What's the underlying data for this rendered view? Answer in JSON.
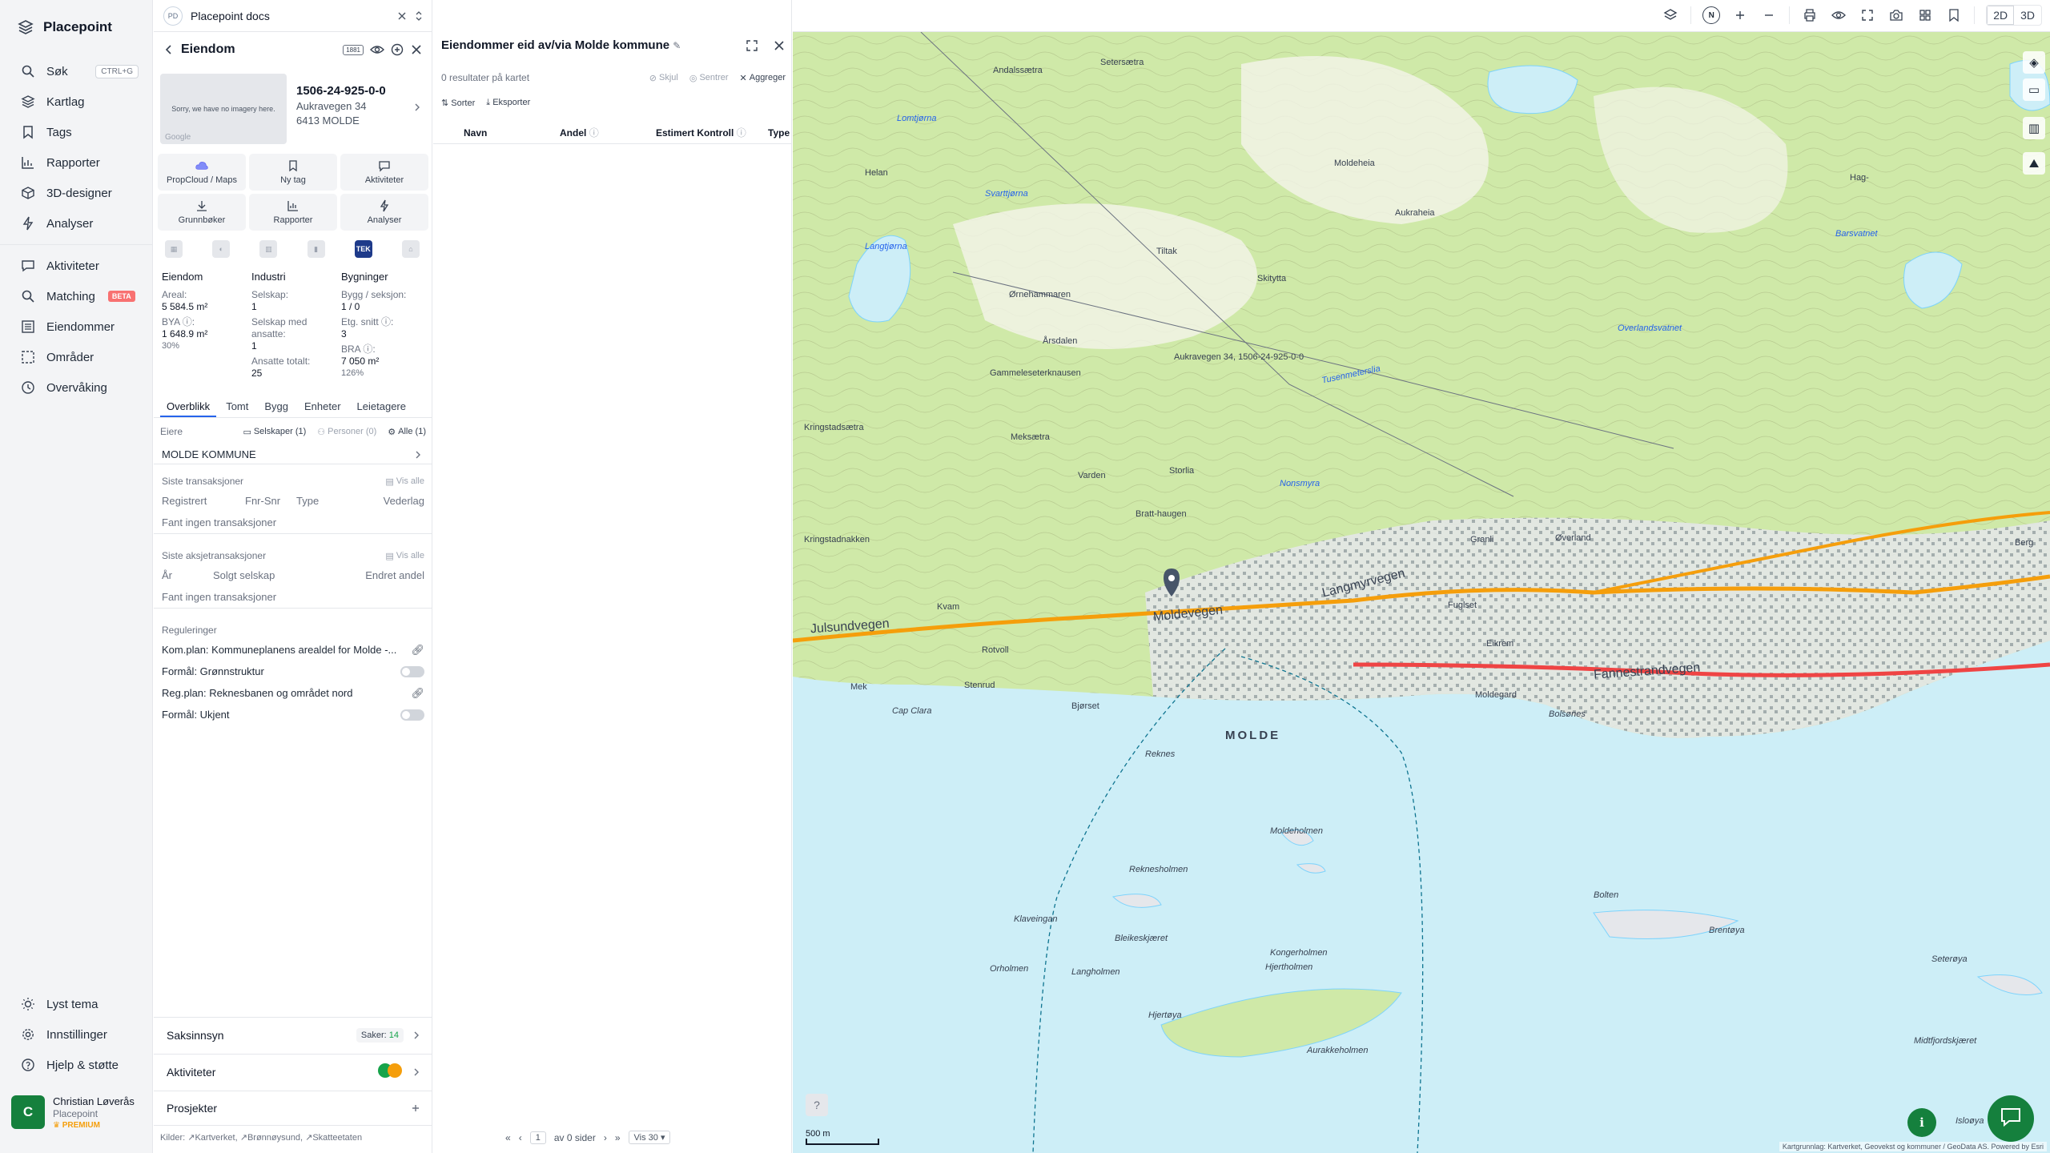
{
  "app": {
    "name": "Placepoint"
  },
  "nav": {
    "items": [
      {
        "label": "Søk",
        "icon": "search-icon",
        "kbd": "CTRL+G"
      },
      {
        "label": "Kartlag",
        "icon": "layers-icon"
      },
      {
        "label": "Tags",
        "icon": "bookmark-icon"
      },
      {
        "label": "Rapporter",
        "icon": "chart-icon"
      },
      {
        "label": "3D-designer",
        "icon": "cube-icon"
      },
      {
        "label": "Analyser",
        "icon": "bolt-icon"
      }
    ],
    "items2": [
      {
        "label": "Aktiviteter",
        "icon": "chat-icon"
      },
      {
        "label": "Matching",
        "icon": "search-icon",
        "badge": "BETA"
      },
      {
        "label": "Eiendommer",
        "icon": "list-icon"
      },
      {
        "label": "Områder",
        "icon": "area-icon"
      },
      {
        "label": "Overvåking",
        "icon": "clock-icon"
      }
    ],
    "bottom": [
      {
        "label": "Lyst tema",
        "icon": "sun-icon"
      },
      {
        "label": "Innstillinger",
        "icon": "gear-icon"
      },
      {
        "label": "Hjelp & støtte",
        "icon": "help-icon"
      }
    ],
    "user": {
      "initial": "C",
      "name": "Christian Løverås",
      "org": "Placepoint",
      "plan": "PREMIUM"
    }
  },
  "panel": {
    "doc": {
      "avatar": "PD",
      "name": "Placepoint docs"
    },
    "title": "Eiendom",
    "badge": "1881",
    "thumb_text": "Sorry, we have no imagery here.",
    "thumb_logo": "Google",
    "property": {
      "id": "1506-24-925-0-0",
      "address": "Aukravegen 34",
      "city": "6413 MOLDE"
    },
    "actions": [
      {
        "label": "PropCloud / Maps",
        "icon": "cloud-icon"
      },
      {
        "label": "Ny tag",
        "icon": "bookmark-icon"
      },
      {
        "label": "Aktiviteter",
        "icon": "chat-icon"
      },
      {
        "label": "Grunnbøker",
        "icon": "download-icon"
      },
      {
        "label": "Rapporter",
        "icon": "chart-icon"
      },
      {
        "label": "Analyser",
        "icon": "bolt-icon"
      }
    ],
    "mini_tek": "TEK",
    "stats": {
      "eiendom": {
        "head": "Eiendom",
        "areal_label": "Areal:",
        "areal": "5 584.5 m²",
        "bya_label": "BYA ⓘ:",
        "bya": "1 648.9 m²",
        "bya_pct": "30%"
      },
      "industri": {
        "head": "Industri",
        "selskap_label": "Selskap:",
        "selskap": "1",
        "ansatte_label": "Selskap med ansatte:",
        "ansatte": "1",
        "totalt_label": "Ansatte totalt:",
        "totalt": "25"
      },
      "bygninger": {
        "head": "Bygninger",
        "bygg_label": "Bygg / seksjon:",
        "bygg": "1 / 0",
        "etg_label": "Etg. snitt ⓘ:",
        "etg": "3",
        "bra_label": "BRA ⓘ:",
        "bra": "7 050 m²",
        "bra_pct": "126%"
      }
    },
    "tabs": [
      "Overblikk",
      "Tomt",
      "Bygg",
      "Enheter",
      "Leietagere"
    ],
    "owners": {
      "label": "Eiere",
      "f1": "Selskaper (1)",
      "f2": "Personer (0)",
      "f3": "Alle (1)",
      "owner": "MOLDE KOMMUNE"
    },
    "transactions": {
      "title": "Siste transaksjoner",
      "vis_alle": "Vis alle",
      "cols": [
        "Registrert",
        "Fnr-Snr",
        "Type",
        "Vederlag"
      ],
      "empty": "Fant ingen transaksjoner"
    },
    "stock": {
      "title": "Siste aksjetransaksjoner",
      "vis_alle": "Vis alle",
      "cols": [
        "År",
        "Solgt selskap",
        "Endret andel"
      ],
      "empty": "Fant ingen transaksjoner"
    },
    "regs": {
      "title": "Reguleringer",
      "rows": [
        {
          "text": "Kom.plan: Kommuneplanens arealdel for Molde -...",
          "type": "link"
        },
        {
          "text": "Formål: Grønnstruktur",
          "type": "toggle"
        },
        {
          "text": "Reg.plan: Reknesbanen og området nord",
          "type": "link"
        },
        {
          "text": "Formål: Ukjent",
          "type": "toggle"
        }
      ]
    },
    "accordions": {
      "saksinnsyn": "Saksinnsyn",
      "saker_label": "Saker:",
      "saker": "14",
      "aktiviteter": "Aktiviteter",
      "prosjekter": "Prosjekter"
    },
    "sources": {
      "label": "Kilder:",
      "items": [
        "Kartverket,",
        "Brønnøysund,",
        "Skatteetaten"
      ]
    }
  },
  "results": {
    "title": "Eiendommer eid av/via Molde kommune",
    "count": "0 resultater på kartet",
    "actions": [
      "Skjul",
      "Sentrer",
      "Aggreger"
    ],
    "tools": [
      "Sorter",
      "Eksporter"
    ],
    "columns": [
      "Navn",
      "Andel",
      "Estimert Kontroll",
      "Type"
    ],
    "pager": {
      "page": "1",
      "of": "av 0 sider",
      "per": "Vis 30"
    }
  },
  "map": {
    "toolbar": {
      "north": "N",
      "mode_2d": "2D",
      "mode_3d": "3D"
    },
    "labels": {
      "town": "MOLDE",
      "road1": "Moldevegen",
      "road2": "Langmyrvegen",
      "road3": "Julsundvegen",
      "road4": "Fannestrandvegen",
      "places": [
        "Andalssætra",
        "Setersætra",
        "Lomtjørna",
        "Helan",
        "Svarttjørna",
        "Langtjørna",
        "Ørnehammaren",
        "Årsdalen",
        "Gammeleseterknausen",
        "Meksætra",
        "Kringstadsætra",
        "Kringstadnakken",
        "Varden",
        "Storlia",
        "Bratt-haugen",
        "Kvam",
        "Rotvoll",
        "Mek",
        "Stenrud",
        "Cap Clara",
        "Bjørset",
        "Reknes",
        "Moldeholmen",
        "Reknesholmen",
        "Klaveingan",
        "Bleikeskjæret",
        "Orholmen",
        "Langholmen",
        "Hjertøya",
        "Kongerholmen",
        "Hjertholmen",
        "Aurakkeholmen",
        "Bolsønes",
        "Bolten",
        "Brentøya",
        "Seterøya",
        "Midtfjordskjæret",
        "Øverland",
        "Granli",
        "Tiltak",
        "Moldeheia",
        "Skitytta",
        "Tusenmeterslia",
        "Nonsmyra",
        "Overlandsvatnet",
        "Moldegard",
        "Fuglset",
        "Eikrem",
        "Aukraheia",
        "Barsvatnet",
        "Hag-",
        "Berg",
        "Isloøya"
      ],
      "pin_label": "Aukravegen 34, 1506-24-925-0-0"
    },
    "scale": "500 m",
    "attribution": "Kartgrunnlag: Kartverket, Geovekst og kommuner / GeoData AS. Powered by Esri"
  }
}
